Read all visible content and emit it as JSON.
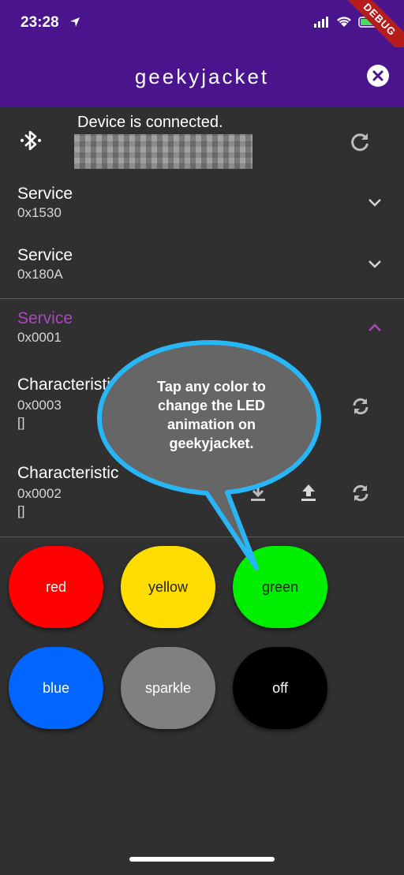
{
  "status_bar": {
    "time": "23:28",
    "debug_banner": "DEBUG"
  },
  "app_bar": {
    "title": "geekyjacket",
    "close_icon": "close-circle-icon"
  },
  "device": {
    "status": "Device is connected.",
    "bluetooth_icon": "bluetooth-connected-icon",
    "refresh_icon": "refresh-icon"
  },
  "services": [
    {
      "title": "Service",
      "uuid": "0x1530",
      "expanded": false
    },
    {
      "title": "Service",
      "uuid": "0x180A",
      "expanded": false
    },
    {
      "title": "Service",
      "uuid": "0x0001",
      "expanded": true
    }
  ],
  "characteristics": [
    {
      "title": "Characteristic",
      "uuid": "0x0003",
      "value": "[]"
    },
    {
      "title": "Characteristic",
      "uuid": "0x0002",
      "value": "[]"
    }
  ],
  "colors": {
    "app_bar": "#4a148c",
    "background": "#303030",
    "accent": "#ab47bc",
    "bubble_outline": "#29b6f6"
  },
  "color_buttons": [
    {
      "label": "red",
      "color": "#ff0000"
    },
    {
      "label": "yellow",
      "color": "#ffdd00"
    },
    {
      "label": "green",
      "color": "#00ee00"
    },
    {
      "label": "blue",
      "color": "#0066ff"
    },
    {
      "label": "sparkle",
      "color": "#808080"
    },
    {
      "label": "off",
      "color": "#000000"
    }
  ],
  "tooltip": {
    "text": "Tap any color to change the LED animation on geekyjacket."
  }
}
